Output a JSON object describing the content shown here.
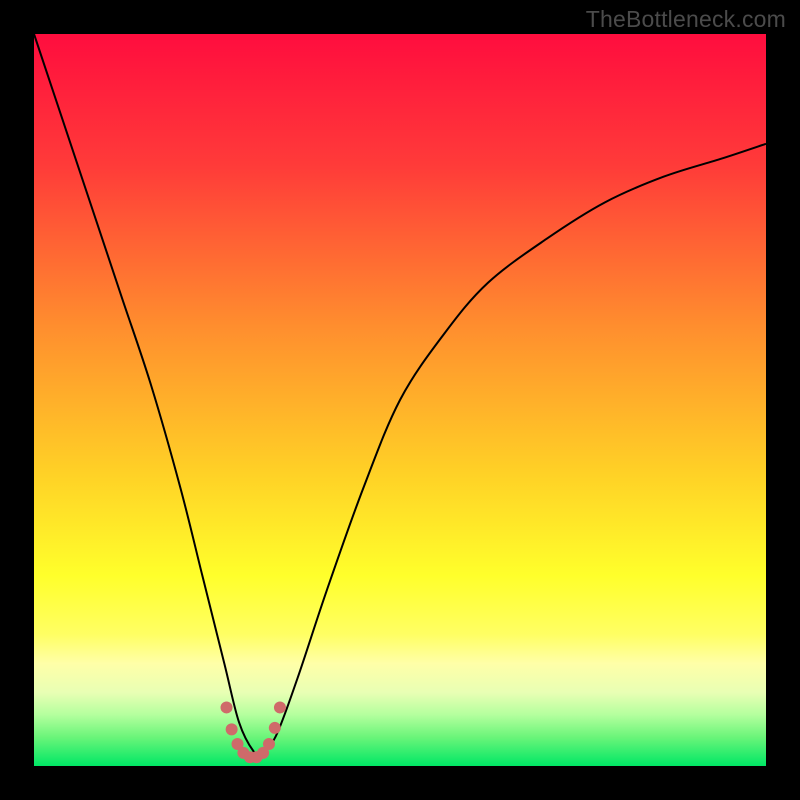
{
  "watermark": "TheBottleneck.com",
  "chart_data": {
    "type": "line",
    "title": "",
    "xlabel": "",
    "ylabel": "",
    "xlim": [
      0,
      100
    ],
    "ylim": [
      0,
      100
    ],
    "gradient_stops": [
      {
        "offset": 0,
        "color": "#ff0d3e"
      },
      {
        "offset": 18,
        "color": "#ff3b39"
      },
      {
        "offset": 40,
        "color": "#ff8e2e"
      },
      {
        "offset": 60,
        "color": "#ffd126"
      },
      {
        "offset": 74,
        "color": "#ffff2b"
      },
      {
        "offset": 82,
        "color": "#ffff63"
      },
      {
        "offset": 86,
        "color": "#ffffa8"
      },
      {
        "offset": 90,
        "color": "#e8ffb4"
      },
      {
        "offset": 93,
        "color": "#b4ff9e"
      },
      {
        "offset": 96,
        "color": "#6cf57a"
      },
      {
        "offset": 100,
        "color": "#00e765"
      }
    ],
    "series": [
      {
        "name": "bottleneck-curve",
        "x": [
          0,
          4,
          8,
          12,
          16,
          20,
          23,
          26,
          28,
          30,
          31,
          33,
          36,
          40,
          45,
          50,
          56,
          62,
          70,
          78,
          86,
          94,
          100
        ],
        "y": [
          100,
          88,
          76,
          64,
          52,
          38,
          26,
          14,
          6,
          2,
          2,
          4,
          12,
          24,
          38,
          50,
          59,
          66,
          72,
          77,
          80.5,
          83,
          85
        ]
      }
    ],
    "markers": {
      "name": "valley-markers",
      "color": "#cf6a6a",
      "radius_px": 6,
      "points": [
        {
          "x": 26.3,
          "y": 8.0
        },
        {
          "x": 27.0,
          "y": 5.0
        },
        {
          "x": 27.8,
          "y": 3.0
        },
        {
          "x": 28.6,
          "y": 1.8
        },
        {
          "x": 29.5,
          "y": 1.2
        },
        {
          "x": 30.4,
          "y": 1.2
        },
        {
          "x": 31.3,
          "y": 1.8
        },
        {
          "x": 32.1,
          "y": 3.0
        },
        {
          "x": 32.9,
          "y": 5.2
        },
        {
          "x": 33.6,
          "y": 8.0
        }
      ]
    }
  }
}
